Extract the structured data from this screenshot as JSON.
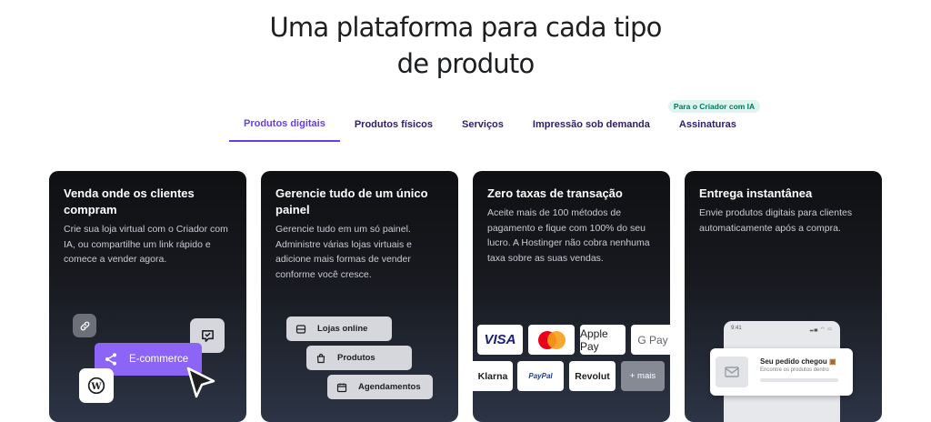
{
  "heading": {
    "line1": "Uma plataforma para cada tipo",
    "line2": "de produto"
  },
  "tabs": [
    {
      "label": "Produtos digitais",
      "active": true
    },
    {
      "label": "Produtos físicos"
    },
    {
      "label": "Serviços"
    },
    {
      "label": "Impressão sob demanda"
    },
    {
      "label": "Assinaturas",
      "badge": "Para o Criador com IA"
    }
  ],
  "cards": [
    {
      "title": "Venda onde os clientes compram",
      "description": "Crie sua loja virtual com o Criador com IA, ou compartilhe um link rápido e comece a vender agora.",
      "ecommerce_label": "E-commerce",
      "icons": [
        "link-icon",
        "chat-icon",
        "share-icon",
        "wordpress-icon",
        "cursor-icon"
      ]
    },
    {
      "title": "Gerencie tudo de um único painel",
      "description": "Gerencie tudo em um só painel. Administre várias lojas virtuais e adicione mais formas de vender conforme você cresce.",
      "items": [
        "Lojas online",
        "Produtos",
        "Agendamentos"
      ]
    },
    {
      "title": "Zero taxas de transação",
      "description": "Aceite mais de 100 métodos de pagamento e fique com 100% do seu lucro. A Hostinger não cobra nenhuma taxa sobre as suas vendas.",
      "payments": [
        "VISA",
        "Apple Pay",
        "G Pay",
        "Klarna",
        "PayPal",
        "Revolut",
        "+ mais"
      ]
    },
    {
      "title": "Entrega instantânea",
      "description": "Envie produtos digitais para clientes automaticamente após a compra.",
      "phone_time": "9:41",
      "notification_title": "Seu pedido chegou",
      "notification_body": "Encontre os produtos dentro"
    }
  ],
  "colors": {
    "accent": "#673de6",
    "ecommerce": "#8c65f7",
    "badge_bg": "#def4f0",
    "badge_text": "#00785a"
  }
}
